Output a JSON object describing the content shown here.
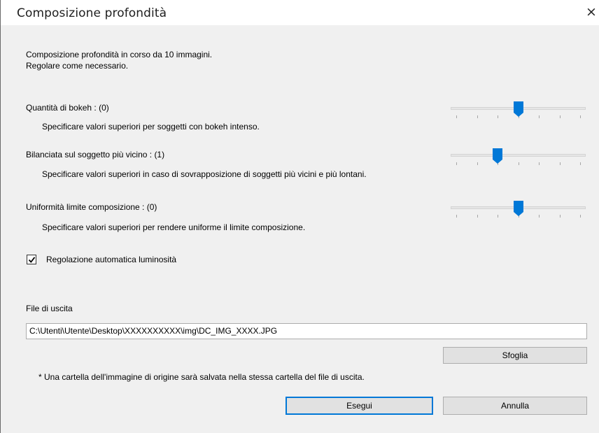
{
  "window": {
    "title": "Composizione profondità",
    "close_glyph": "×"
  },
  "intro": {
    "line1": "Composizione profondità in corso da 10 immagini.",
    "line2": "Regolare come necessario."
  },
  "settings": [
    {
      "label": "Quantità di bokeh : (0)",
      "description": "Specificare valori superiori per soggetti con bokeh intenso.",
      "slider_position": 0.5
    },
    {
      "label": "Bilanciata sul soggetto più vicino : (1)",
      "description": "Specificare valori superiori in caso di sovrapposizione di soggetti più vicini e più lontani.",
      "slider_position": 0.333
    },
    {
      "label": "Uniformità limite composizione : (0)",
      "description": "Specificare valori superiori per rendere uniforme il limite composizione.",
      "slider_position": 0.5
    }
  ],
  "auto_brightness": {
    "label": "Regolazione automatica luminosità",
    "checked": true
  },
  "output": {
    "label": "File di uscita",
    "path": "C:\\Utenti\\Utente\\Desktop\\XXXXXXXXXX\\img\\DC_IMG_XXXX.JPG",
    "browse_label": "Sfoglia",
    "note": "* Una cartella dell'immagine di origine sarà salvata nella stessa cartella del file di uscita."
  },
  "actions": {
    "execute_label": "Esegui",
    "cancel_label": "Annulla"
  },
  "colors": {
    "accent": "#0078d7",
    "background": "#f0f0f0"
  }
}
